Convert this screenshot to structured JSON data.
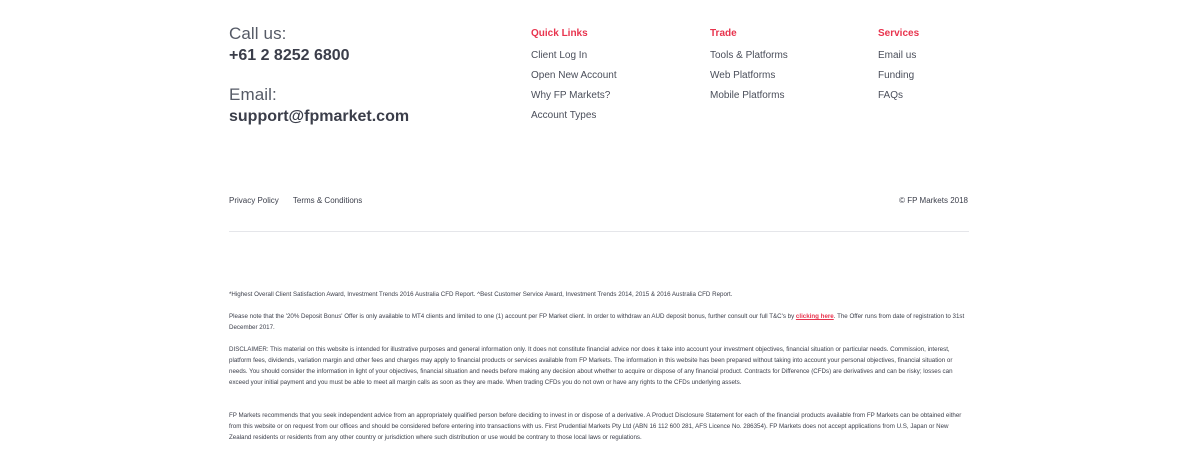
{
  "contact": {
    "call_label": "Call us:",
    "phone": "+61 2 8252 6800",
    "email_label": "Email:",
    "email": "support@fpmarket.com"
  },
  "quick_links": {
    "title": "Quick Links",
    "items": [
      "Client Log In",
      "Open New Account",
      "Why FP Markets?",
      "Account Types"
    ]
  },
  "trade": {
    "title": "Trade",
    "items": [
      "Tools & Platforms",
      "Web Platforms",
      "Mobile Platforms"
    ]
  },
  "services": {
    "title": "Services",
    "items": [
      "Email us",
      "Funding",
      "FAQs"
    ]
  },
  "footer": {
    "privacy": "Privacy Policy",
    "terms": "Terms & Conditions",
    "copyright": "© FP Markets 2018"
  },
  "fine_print": {
    "awards": "*Highest Overall Client Satisfaction Award, Investment Trends 2016 Australia CFD Report. ^Best Customer Service Award, Investment Trends 2014, 2015 & 2016 Australia CFD Report.",
    "bonus_before": "Please note that the '20% Deposit Bonus' Offer is only available to MT4 clients and limited to one (1) account per FP Market client. In order to withdraw an AUD deposit bonus, further consult our full T&C's by ",
    "bonus_link": "clicking here",
    "bonus_after": ". The Offer runs from date of registration to 31st December 2017.",
    "disclaimer": "DISCLAIMER: This material on this website is intended for illustrative purposes and general information only. It does not constitute financial advice nor does it take into account your investment objectives, financial situation or particular needs. Commission, interest, platform fees, dividends, variation margin and other fees and charges may apply to financial products or services available from FP Markets. The information in this website has been prepared without taking into account your personal objectives, financial situation or needs. You should consider the information in light of your objectives, financial situation and needs before making any decision about whether to acquire or dispose of any financial product. Contracts for Difference (CFDs) are derivatives and can be risky; losses can exceed your initial payment and you must be able to meet all margin calls as soon as they are made. When trading CFDs you do not own or have any rights to the CFDs underlying assets.",
    "pds": "FP Markets recommends that you seek independent advice from an appropriately qualified person before deciding to invest in or dispose of a derivative. A Product Disclosure Statement for each of the financial products available from FP Markets can be obtained either from this website or on request from our offices and should be considered before entering into transactions with us. First Prudential Markets Pty Ltd (ABN 16 112 600 281, AFS Licence No. 286354). FP Markets does not accept applications from U.S, Japan or New Zealand residents or residents from any other country or jurisdiction where such distribution or use would be contrary to those local laws or regulations."
  }
}
